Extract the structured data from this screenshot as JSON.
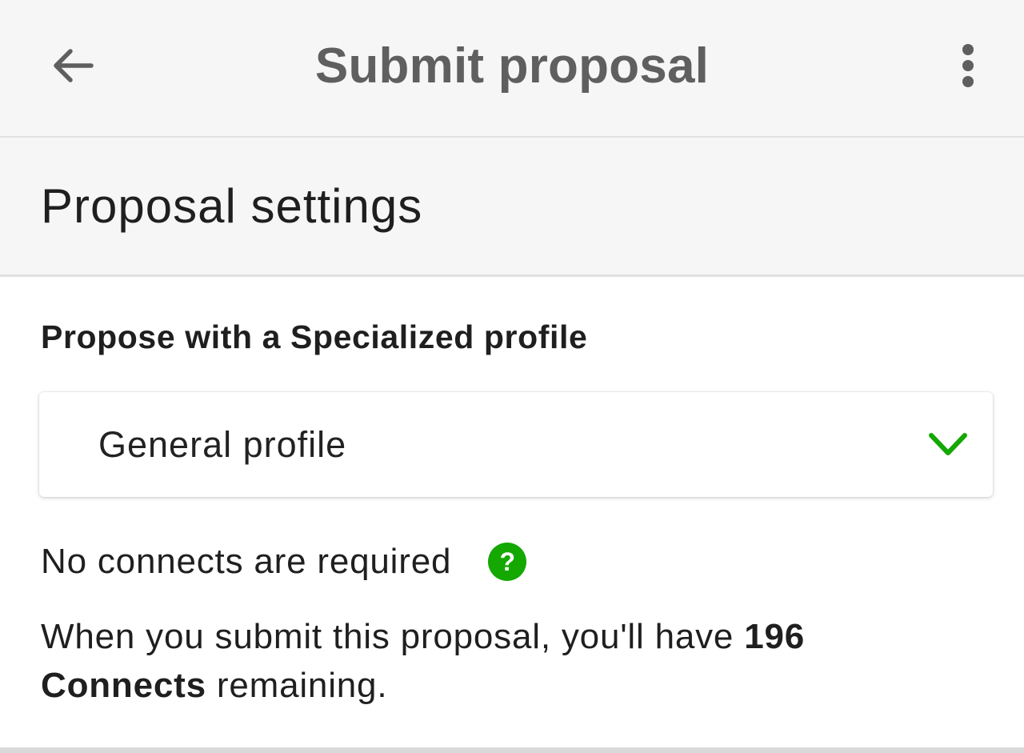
{
  "app_bar": {
    "title": "Submit proposal",
    "back_icon": "arrow-left-icon",
    "more_icon": "more-vertical-icon"
  },
  "section": {
    "title": "Proposal settings"
  },
  "profile_field": {
    "label": "Propose with a Specialized profile",
    "selected_value": "General profile",
    "chevron_icon": "chevron-down-icon"
  },
  "connects": {
    "required_text": "No connects are required",
    "help_icon": "help-circle-icon",
    "help_glyph": "?",
    "remaining_prefix": "When you submit this proposal, you'll have",
    "remaining_bold": "196 Connects",
    "remaining_suffix": "remaining."
  },
  "colors": {
    "accent": "#14a800",
    "app_bar_bg": "#f6f6f6",
    "title_text": "#5f5f5f",
    "body_text": "#1f1f1f"
  }
}
